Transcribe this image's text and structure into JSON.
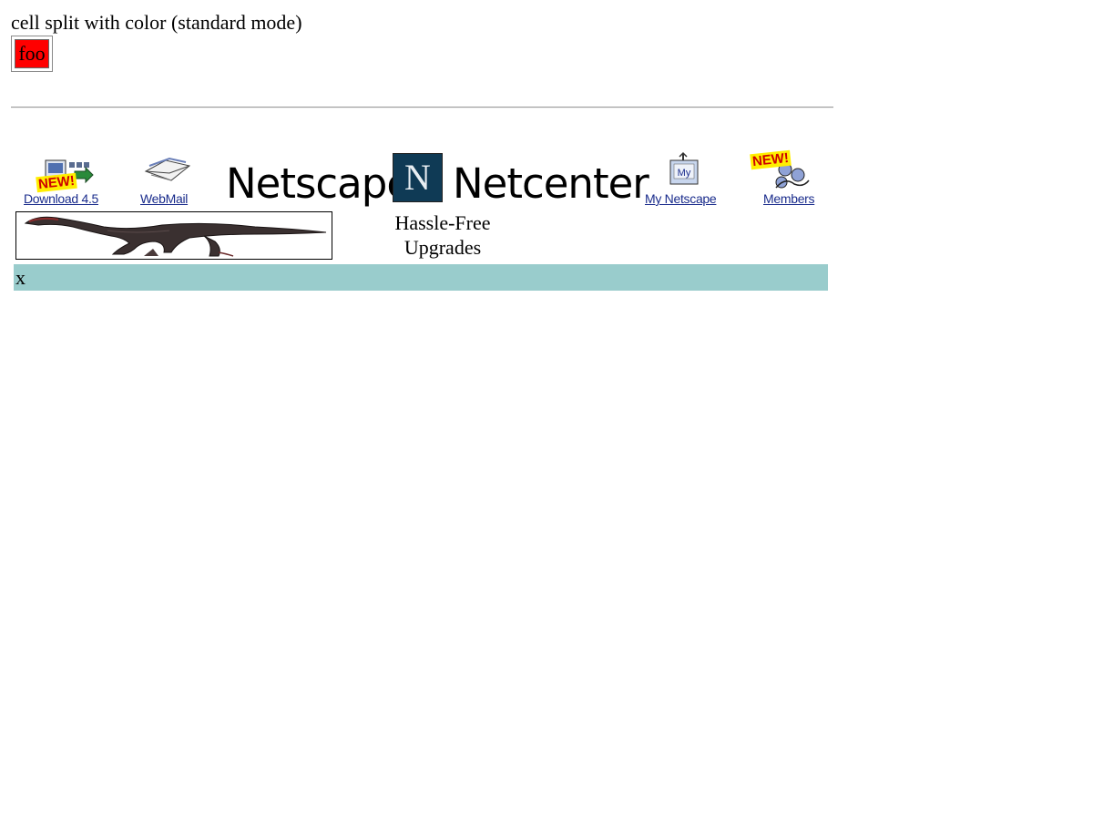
{
  "heading": "cell split with color (standard mode)",
  "cell": {
    "text": "foo",
    "background": "#ff0000"
  },
  "nav": {
    "download": {
      "label": "Download 4.5",
      "badge": "NEW!",
      "icon": "download-icon"
    },
    "webmail": {
      "label": "WebMail",
      "icon": "webmail-icon"
    },
    "my_netscape": {
      "label": "My Netscape",
      "icon": "my-netscape-icon",
      "icon_text": "My"
    },
    "members": {
      "label": "Members",
      "badge": "NEW!",
      "icon": "members-icon"
    }
  },
  "brand": {
    "left_word": "Netscape",
    "logo_letter": "N",
    "right_word": "Netcenter"
  },
  "tagline": "Hassle-Free Upgrades",
  "bar": {
    "text": "x",
    "background": "#99cccc"
  },
  "colors": {
    "link": "#1a2c8c",
    "badge_text": "#cc0000",
    "badge_background": "#ffee00",
    "logo_background": "#0f3a55"
  }
}
